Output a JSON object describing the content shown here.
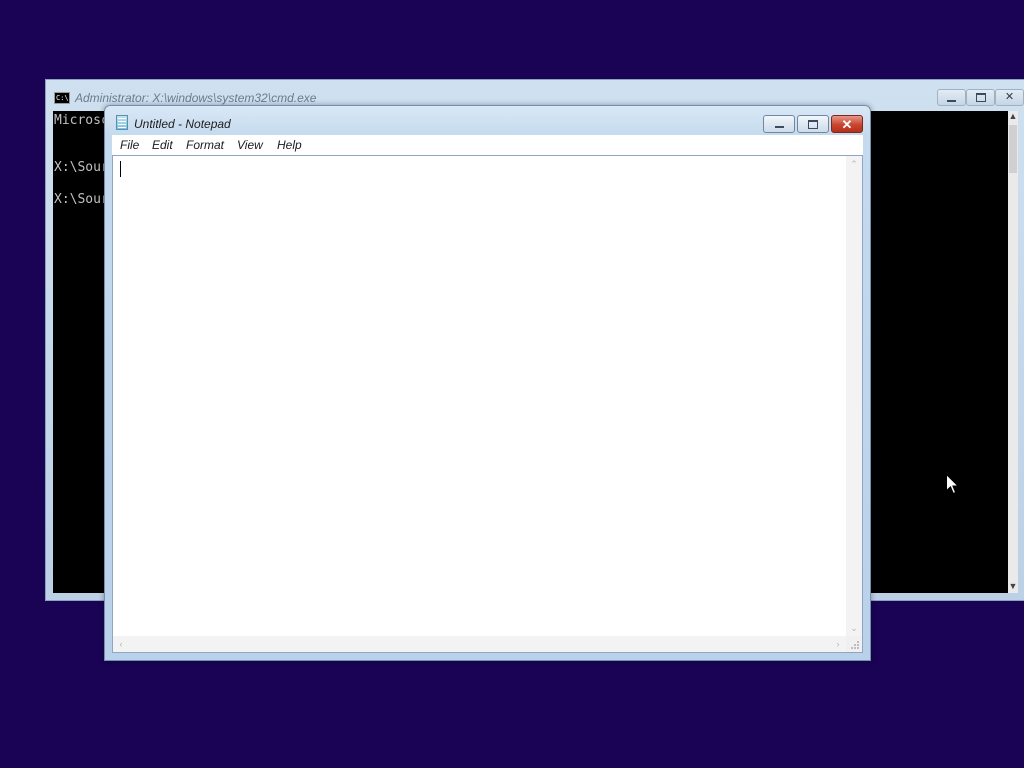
{
  "cmd": {
    "title": "Administrator: X:\\windows\\system32\\cmd.exe",
    "icon_text": "C:\\",
    "lines": [
      "Microsc",
      "X:\\Sour",
      "X:\\Sour"
    ]
  },
  "notepad": {
    "title": "Untitled - Notepad",
    "menu": [
      "File",
      "Edit",
      "Format",
      "View",
      "Help"
    ],
    "content": ""
  },
  "colors": {
    "desktop": "#1a0355",
    "close_button": "#c9452e"
  },
  "icons": {
    "cmd": "cmd-icon",
    "notepad": "notepad-icon",
    "cursor": "mouse-pointer-icon"
  }
}
